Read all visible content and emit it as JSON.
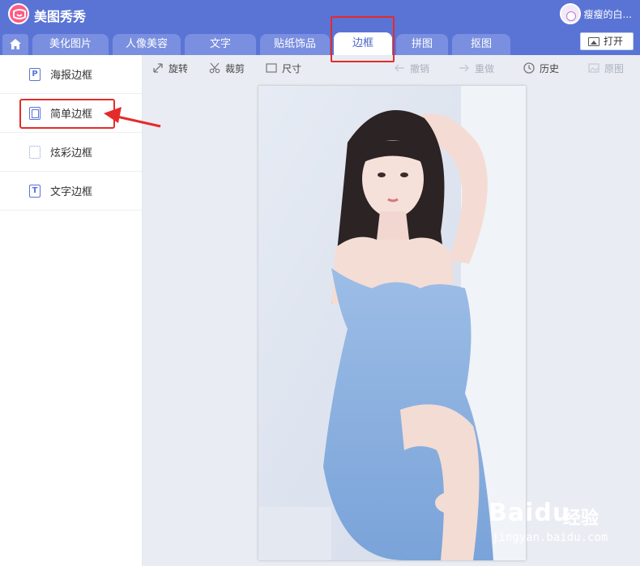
{
  "app": {
    "name": "美图秀秀"
  },
  "user": {
    "name": "瘦瘦的白..."
  },
  "tabs": [
    {
      "label": "美化图片"
    },
    {
      "label": "人像美容"
    },
    {
      "label": "文字"
    },
    {
      "label": "贴纸饰品"
    },
    {
      "label": "边框"
    },
    {
      "label": "拼图"
    },
    {
      "label": "抠图"
    }
  ],
  "active_tab": "边框",
  "open_button": {
    "label": "打开"
  },
  "sidebar": {
    "items": [
      {
        "label": "海报边框",
        "icon": "P"
      },
      {
        "label": "简单边框"
      },
      {
        "label": "炫彩边框"
      },
      {
        "label": "文字边框",
        "icon": "T"
      }
    ],
    "selected": "简单边框"
  },
  "toolbar": {
    "rotate": "旋转",
    "crop": "裁剪",
    "size": "尺寸",
    "undo": "撤销",
    "redo": "重做",
    "history": "历史",
    "original": "原图"
  },
  "watermark": {
    "brand": "Baidu",
    "product": "经验",
    "url": "jingyan.baidu.com"
  },
  "colors": {
    "header": "#5a74d6",
    "tab_inactive": "#7a8fe0",
    "highlight": "#e42b2b"
  }
}
